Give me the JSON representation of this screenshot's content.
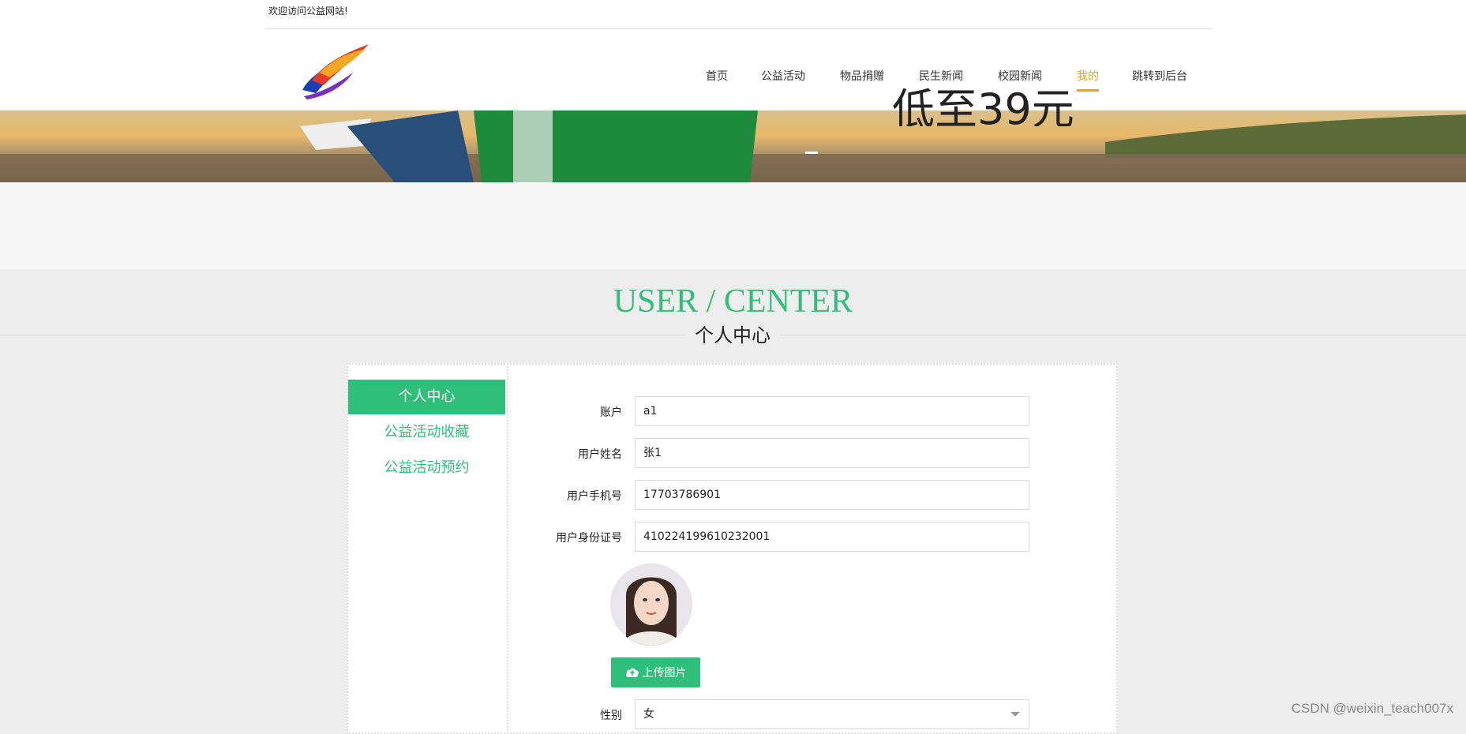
{
  "header": {
    "welcome_text": "欢迎访问公益网站!",
    "nav": [
      {
        "label": "首页"
      },
      {
        "label": "公益活动"
      },
      {
        "label": "物品捐赠"
      },
      {
        "label": "民生新闻"
      },
      {
        "label": "校园新闻"
      },
      {
        "label": "我的",
        "active": true
      },
      {
        "label": "跳转到后台"
      }
    ]
  },
  "banner": {
    "text": "低至39元"
  },
  "section": {
    "title_en": "USER / CENTER",
    "title_cn": "个人中心"
  },
  "sidebar": {
    "items": [
      {
        "label": "个人中心",
        "active": true
      },
      {
        "label": "公益活动收藏"
      },
      {
        "label": "公益活动预约"
      }
    ]
  },
  "form": {
    "account_label": "账户",
    "account_value": "a1",
    "name_label": "用户姓名",
    "name_value": "张1",
    "phone_label": "用户手机号",
    "phone_value": "17703786901",
    "idcard_label": "用户身份证号",
    "idcard_value": "410224199610232001",
    "upload_label": "上传图片",
    "gender_label": "性别",
    "gender_value": "女"
  },
  "watermark": "CSDN @weixin_teach007x",
  "colors": {
    "accent": "#2fbf7a",
    "nav_active": "#e5a811"
  }
}
